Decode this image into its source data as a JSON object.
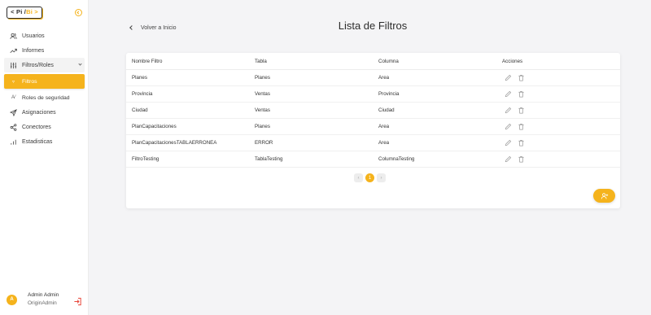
{
  "logo": {
    "left": "< Pi /",
    "right": "Bi >"
  },
  "nav": {
    "items": [
      {
        "label": "Usuarios",
        "icon": "users-icon"
      },
      {
        "label": "Informes",
        "icon": "trend-icon"
      },
      {
        "label": "Filtros/Roles",
        "icon": "sliders-icon"
      },
      {
        "label": "Filtros",
        "icon": "filter-icon"
      },
      {
        "label": "Roles de seguridad",
        "icon": "roles-icon"
      },
      {
        "label": "Asignaciones",
        "icon": "send-icon"
      },
      {
        "label": "Conectores",
        "icon": "share-icon"
      },
      {
        "label": "Estadisticas",
        "icon": "bar-chart-icon"
      }
    ]
  },
  "user": {
    "initial": "A",
    "name": "Admin Admin",
    "role": "OriginAdmin"
  },
  "header": {
    "back_label": "Volver a Inicio",
    "title": "Lista de Filtros"
  },
  "table": {
    "columns": [
      "Nombre Filtro",
      "Tabla",
      "Columna",
      "Acciones"
    ],
    "rows": [
      [
        "Planes",
        "Planes",
        "Area"
      ],
      [
        "Provincia",
        "Ventas",
        "Provincia"
      ],
      [
        "Ciudad",
        "Ventas",
        "Ciudad"
      ],
      [
        "PlanCapacitaciones",
        "Planes",
        "Area"
      ],
      [
        "PlanCapacitacionesTABLAERRONEA",
        "ERROR",
        "Area"
      ],
      [
        "FiltroTesting",
        "TablaTesting",
        "ColumnaTesting"
      ]
    ]
  },
  "pagination": {
    "prev": "‹",
    "current": "1",
    "next": "›"
  },
  "colors": {
    "accent": "#f5b31c",
    "background": "#f4f4f6"
  }
}
